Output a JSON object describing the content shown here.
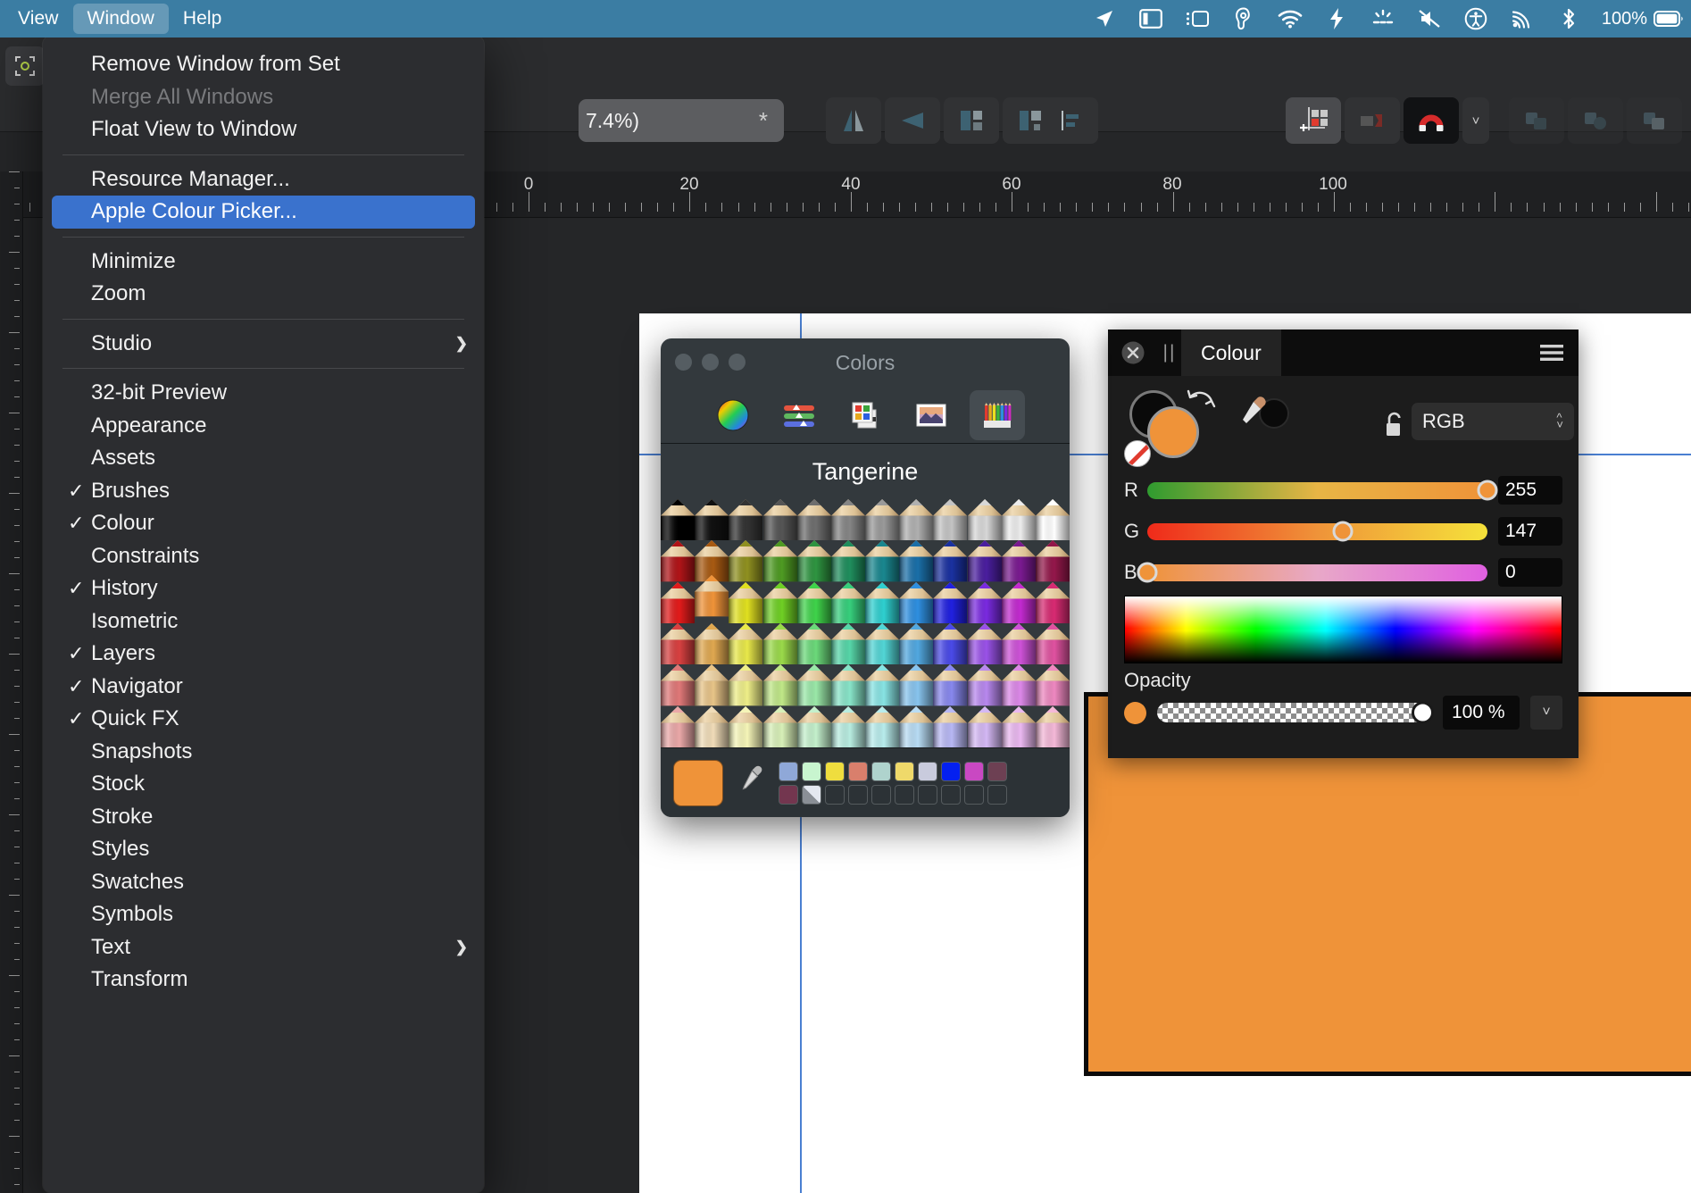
{
  "menubar": {
    "items": [
      {
        "label": "View",
        "active": false
      },
      {
        "label": "Window",
        "active": true
      },
      {
        "label": "Help",
        "active": false
      }
    ],
    "status_icons": [
      "location-arrow-icon",
      "display-sidebar-icon",
      "stage-manager-icon",
      "hearing-ear-icon",
      "wifi-icon",
      "shortcuts-icon",
      "brightness-icon",
      "mute-speaker-icon",
      "accessibility-icon",
      "airplay-icon",
      "bluetooth-icon"
    ],
    "battery_percent": "100%",
    "accent_bar_color": "#3b7da3"
  },
  "window_menu": {
    "title": "Window",
    "groups": [
      {
        "items": [
          {
            "label": "Remove Window from Set",
            "checked": false,
            "enabled": true,
            "submenu": false,
            "selected": false
          },
          {
            "label": "Merge All Windows",
            "checked": false,
            "enabled": false,
            "submenu": false,
            "selected": false
          },
          {
            "label": "Float View to Window",
            "checked": false,
            "enabled": true,
            "submenu": false,
            "selected": false
          }
        ]
      },
      {
        "items": [
          {
            "label": "Resource Manager...",
            "checked": false,
            "enabled": true,
            "submenu": false,
            "selected": false
          },
          {
            "label": "Apple Colour Picker...",
            "checked": false,
            "enabled": true,
            "submenu": false,
            "selected": true
          }
        ]
      },
      {
        "items": [
          {
            "label": "Minimize",
            "checked": false,
            "enabled": true,
            "submenu": false,
            "selected": false
          },
          {
            "label": "Zoom",
            "checked": false,
            "enabled": true,
            "submenu": false,
            "selected": false
          }
        ]
      },
      {
        "items": [
          {
            "label": "Studio",
            "checked": false,
            "enabled": true,
            "submenu": true,
            "selected": false
          }
        ]
      },
      {
        "items": [
          {
            "label": "32-bit Preview",
            "checked": false,
            "enabled": true,
            "submenu": false,
            "selected": false
          },
          {
            "label": "Appearance",
            "checked": false,
            "enabled": true,
            "submenu": false,
            "selected": false
          },
          {
            "label": "Assets",
            "checked": false,
            "enabled": true,
            "submenu": false,
            "selected": false
          },
          {
            "label": "Brushes",
            "checked": true,
            "enabled": true,
            "submenu": false,
            "selected": false
          },
          {
            "label": "Colour",
            "checked": true,
            "enabled": true,
            "submenu": false,
            "selected": false
          },
          {
            "label": "Constraints",
            "checked": false,
            "enabled": true,
            "submenu": false,
            "selected": false
          },
          {
            "label": "History",
            "checked": true,
            "enabled": true,
            "submenu": false,
            "selected": false
          },
          {
            "label": "Isometric",
            "checked": false,
            "enabled": true,
            "submenu": false,
            "selected": false
          },
          {
            "label": "Layers",
            "checked": true,
            "enabled": true,
            "submenu": false,
            "selected": false
          },
          {
            "label": "Navigator",
            "checked": true,
            "enabled": true,
            "submenu": false,
            "selected": false
          },
          {
            "label": "Quick FX",
            "checked": true,
            "enabled": true,
            "submenu": false,
            "selected": false
          },
          {
            "label": "Snapshots",
            "checked": false,
            "enabled": true,
            "submenu": false,
            "selected": false
          },
          {
            "label": "Stock",
            "checked": false,
            "enabled": true,
            "submenu": false,
            "selected": false
          },
          {
            "label": "Stroke",
            "checked": false,
            "enabled": true,
            "submenu": false,
            "selected": false
          },
          {
            "label": "Styles",
            "checked": false,
            "enabled": true,
            "submenu": false,
            "selected": false
          },
          {
            "label": "Swatches",
            "checked": false,
            "enabled": true,
            "submenu": false,
            "selected": false
          },
          {
            "label": "Symbols",
            "checked": false,
            "enabled": true,
            "submenu": false,
            "selected": false
          },
          {
            "label": "Text",
            "checked": false,
            "enabled": true,
            "submenu": true,
            "selected": false
          },
          {
            "label": "Transform",
            "checked": false,
            "enabled": true,
            "submenu": false,
            "selected": false
          }
        ]
      }
    ],
    "checkmark_glyph": "✓",
    "submenu_glyph": "›",
    "highlight_color": "#3a72cd"
  },
  "toolbar": {
    "zoom_field_value": "7.4%)",
    "zoom_field_modified_glyph": "*",
    "buttons": [
      {
        "name": "flip-horizontal-button",
        "selected": false
      },
      {
        "name": "flip-vertical-button",
        "selected": false
      },
      {
        "name": "align-left-edges-button",
        "selected": false
      },
      {
        "name": "align-right-edges-button",
        "selected": false
      },
      {
        "name": "align-text-left-button",
        "selected": false
      },
      {
        "name": "snapping-grid-button",
        "selected": true
      },
      {
        "name": "snap-to-object-button",
        "selected": false
      },
      {
        "name": "magnet-snapping-button",
        "selected": true
      },
      {
        "name": "snapping-options-chevron",
        "selected": false
      },
      {
        "name": "boolean-add-button",
        "selected": false
      },
      {
        "name": "boolean-subtract-button",
        "selected": false
      },
      {
        "name": "boolean-intersect-button",
        "selected": false
      }
    ]
  },
  "ruler": {
    "labels": [
      "0",
      "20",
      "40",
      "60",
      "80",
      "100"
    ],
    "positions": [
      592,
      772,
      953,
      1133,
      1313,
      1493
    ],
    "spacing_px": 180.4
  },
  "colors_window": {
    "title": "Colors",
    "tabs": [
      {
        "name": "color-wheel-tab",
        "selected": false
      },
      {
        "name": "color-sliders-tab",
        "selected": false
      },
      {
        "name": "color-palettes-tab",
        "selected": false
      },
      {
        "name": "image-palettes-tab",
        "selected": false
      },
      {
        "name": "pencils-tab",
        "selected": true
      }
    ],
    "selected_color_name": "Tangerine",
    "selected_color_hex": "#ef9339",
    "traffic_lights": [
      "close",
      "minimize",
      "zoom"
    ],
    "eyedropper_icon": "eyedropper-icon",
    "pencil_grid": {
      "columns": 12,
      "rows": 6,
      "colors": [
        [
          "#000000",
          "#101010",
          "#333333",
          "#555555",
          "#6e6e6e",
          "#858585",
          "#9a9a9a",
          "#b0b0b0",
          "#c4c4c4",
          "#d8d8d8",
          "#ececec",
          "#ffffff"
        ],
        [
          "#b01418",
          "#a85a12",
          "#8f9020",
          "#4e9a22",
          "#2e9440",
          "#1f8e5d",
          "#19878f",
          "#1a6fa8",
          "#1a31a0",
          "#4a1e9e",
          "#7a1a90",
          "#93174a"
        ],
        [
          "#e21b1b",
          "#ef9339",
          "#e0e020",
          "#6fd024",
          "#3fd34a",
          "#36cf7c",
          "#2ed0d0",
          "#2e8fe0",
          "#2020e0",
          "#7a2ae0",
          "#c32ad0",
          "#d82a72"
        ],
        [
          "#d84040",
          "#e0a850",
          "#e8e84a",
          "#9ada4a",
          "#6bd97a",
          "#56d6a8",
          "#52d6d6",
          "#52a8e0",
          "#4a4ae8",
          "#9a52e8",
          "#ce52d8",
          "#e052a0"
        ],
        [
          "#e07878",
          "#e8c488",
          "#eeee88",
          "#c0e888",
          "#9ae8a8",
          "#88e4c8",
          "#88e4e4",
          "#88c4ee",
          "#8888ee",
          "#b888ee",
          "#dc88e8",
          "#ee88c0"
        ],
        [
          "#eaa8a8",
          "#f0dcb8",
          "#f5f5b8",
          "#d8f0b8",
          "#c4f0cc",
          "#b8ece0",
          "#b8ecec",
          "#b8dcf4",
          "#b8b8f4",
          "#d4b8f4",
          "#eab8f0",
          "#f4b8d8"
        ]
      ]
    },
    "palette_row1": [
      "#8fa8d8",
      "#c8f5cf",
      "#efdd3e",
      "#d97f6c",
      "#afd3cd",
      "#efd96a",
      "#c9cbdd",
      "#0420f0",
      "#c948c2",
      "#6d4053"
    ],
    "palette_row2": [
      "#73364f",
      "#a8aab3",
      "",
      "",
      "",
      "",
      "",
      "",
      "",
      ""
    ]
  },
  "colour_panel": {
    "tab_label": "Colour",
    "close_icon": "close-circle-icon",
    "grip_icon": "drag-grip-icon",
    "menu_icon": "hamburger-menu-icon",
    "lock_icon": "unlocked-padlock-icon",
    "rotate_icon": "swap-fill-stroke-icon",
    "picker_icon": "colour-picker-icon",
    "model": "RGB",
    "fill_color_hex": "#ef9339",
    "stroke_color_hex": "#000000",
    "sliders": [
      {
        "label": "R",
        "value": "255",
        "pos_pct": 100
      },
      {
        "label": "G",
        "value": "147",
        "pos_pct": 57.6
      },
      {
        "label": "B",
        "value": "0",
        "pos_pct": 0
      }
    ],
    "opacity_label": "Opacity",
    "opacity_value": "100 %",
    "opacity_pos_pct": 100
  },
  "canvas": {
    "paper_color": "#ffffff",
    "guide_color": "#4a7fd1",
    "shape_fill": "#ef9339",
    "shape_stroke": "#0b0b0b"
  }
}
